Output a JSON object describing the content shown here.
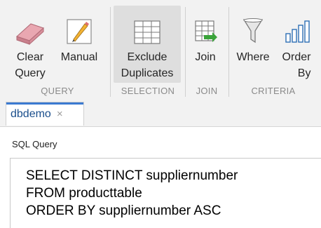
{
  "toolstrip": {
    "tools": [
      {
        "label_line1": "Clear",
        "label_line2": "Query",
        "icon": "eraser-icon"
      },
      {
        "label_line1": "Manual",
        "label_line2": "",
        "icon": "pencil-icon"
      },
      {
        "label_line1": "Exclude",
        "label_line2": "Duplicates",
        "icon": "table-grid-icon"
      },
      {
        "label_line1": "Join",
        "label_line2": "",
        "icon": "join-table-icon"
      },
      {
        "label_line1": "Where",
        "label_line2": "",
        "icon": "filter-funnel-icon"
      },
      {
        "label_line1": "Order",
        "label_line2": "By",
        "icon": "sort-bars-icon"
      }
    ],
    "groups": {
      "query": "QUERY",
      "selection": "SELECTION",
      "join": "JOIN",
      "criteria": "CRITERIA"
    }
  },
  "tabs": [
    {
      "label": "dbdemo",
      "close_glyph": "×"
    }
  ],
  "sql_panel": {
    "label": "SQL Query",
    "lines": [
      "SELECT DISTINCT suppliernumber",
      "FROM producttable",
      "ORDER BY suppliernumber ASC"
    ]
  },
  "colors": {
    "toolstrip_bg": "#f2f2f2",
    "selected_bg": "#dedede",
    "tab_accent": "#3b7ad1",
    "icon_blue": "#2d6fb5",
    "icon_green": "#3aa33a"
  }
}
